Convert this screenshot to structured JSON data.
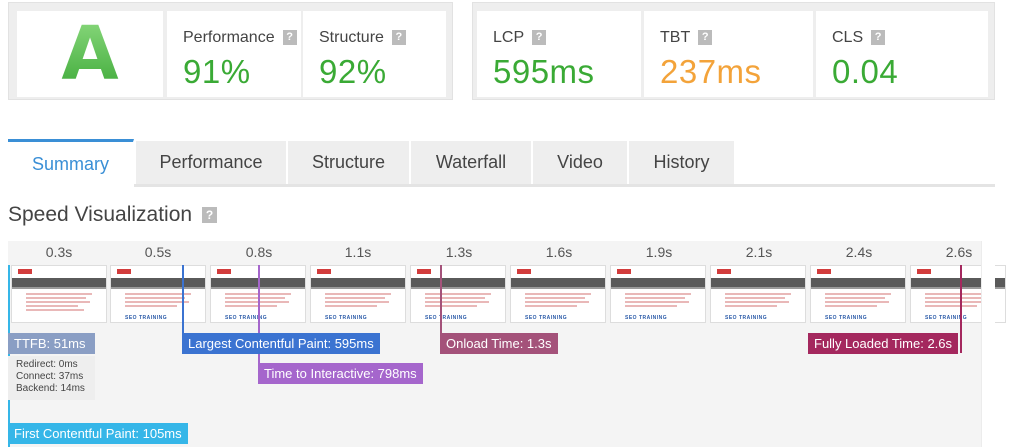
{
  "grades": {
    "letter": "A",
    "performance": {
      "label": "Performance",
      "value": "91%"
    },
    "structure": {
      "label": "Structure",
      "value": "92%"
    },
    "help_glyph": "?"
  },
  "vitals": {
    "lcp": {
      "label": "LCP",
      "value": "595ms",
      "color": "#3aaa35"
    },
    "tbt": {
      "label": "TBT",
      "value": "237ms",
      "color": "#f3a33a"
    },
    "cls": {
      "label": "CLS",
      "value": "0.04",
      "color": "#3aaa35"
    }
  },
  "tabs": [
    {
      "label": "Summary",
      "active": true
    },
    {
      "label": "Performance"
    },
    {
      "label": "Structure"
    },
    {
      "label": "Waterfall"
    },
    {
      "label": "Video"
    },
    {
      "label": "History"
    }
  ],
  "section_title": "Speed Visualization",
  "visualization": {
    "times": [
      "0.3s",
      "0.5s",
      "0.8s",
      "1.1s",
      "1.3s",
      "1.6s",
      "1.9s",
      "2.1s",
      "2.4s",
      "2.6s"
    ],
    "frame_logo": "SEO TRAINING",
    "markers": {
      "ttfb": {
        "label": "TTFB: 51ms",
        "color": "#8a9ec4"
      },
      "redirect": "Redirect: 0ms",
      "connect": "Connect: 37ms",
      "backend": "Backend: 14ms",
      "lcp": {
        "label": "Largest Contentful Paint: 595ms",
        "color": "#3b73d1"
      },
      "tti": {
        "label": "Time to Interactive: 798ms",
        "color": "#a566cc"
      },
      "onload": {
        "label": "Onload Time: 1.3s",
        "color": "#a4527a"
      },
      "fully": {
        "label": "Fully Loaded Time: 2.6s",
        "color": "#a4285e"
      },
      "fcp": {
        "label": "First Contentful Paint: 105ms",
        "color": "#35b6e8"
      }
    }
  }
}
